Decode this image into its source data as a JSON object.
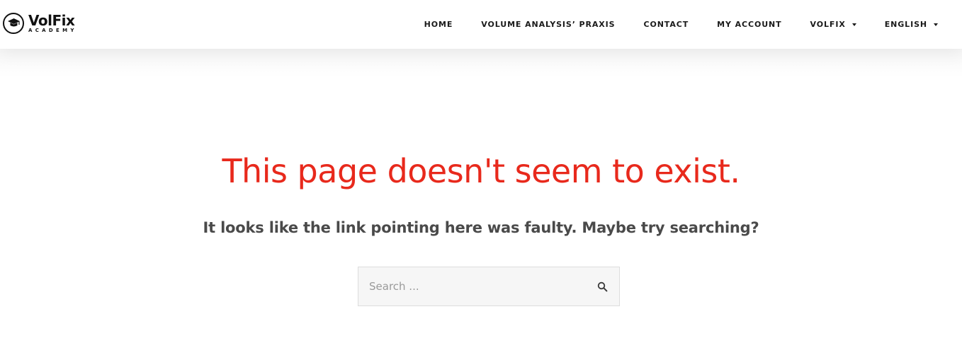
{
  "logo": {
    "name": "VolFix",
    "tagline": "ACADEMY",
    "icon": "graduation-cap-icon"
  },
  "nav": {
    "items": [
      {
        "label": "HOME",
        "has_dropdown": false
      },
      {
        "label": "VOLUME ANALYSIS’ PRAXIS",
        "has_dropdown": false
      },
      {
        "label": "CONTACT",
        "has_dropdown": false
      },
      {
        "label": "MY ACCOUNT",
        "has_dropdown": false
      },
      {
        "label": "VOLFIX",
        "has_dropdown": true
      },
      {
        "label": "ENGLISH",
        "has_dropdown": true
      }
    ]
  },
  "error": {
    "title": "This page doesn't seem to exist.",
    "message": "It looks like the link pointing here was faulty. Maybe try searching?"
  },
  "search": {
    "placeholder": "Search ...",
    "value": "",
    "icon": "search-icon"
  },
  "colors": {
    "accent": "#e8291c",
    "text_dark": "#1a1a1a",
    "text_muted": "#4a4a4a",
    "input_bg": "#f6f6f6",
    "input_border": "#dddddd"
  }
}
